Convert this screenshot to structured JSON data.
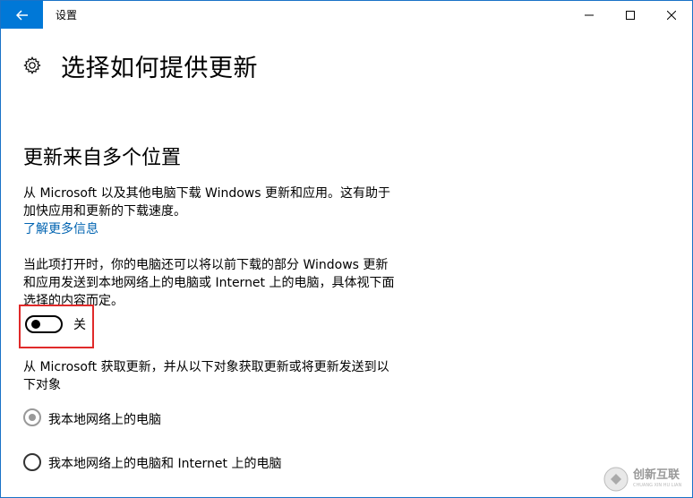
{
  "window": {
    "title": "设置"
  },
  "header": {
    "title": "选择如何提供更新",
    "icon": "gear-icon"
  },
  "section": {
    "title": "更新来自多个位置",
    "description": [
      "从 Microsoft 以及其他电脑下载 Windows 更新和应用。这有助于",
      "加快应用和更新的下载速度。"
    ],
    "link": "了解更多信息",
    "toggle_description": [
      "当此项打开时，你的电脑还可以将以前下载的部分 Windows 更新",
      "和应用发送到本地网络上的电脑或 Internet 上的电脑，具体视下面",
      "选择的内容而定。"
    ],
    "toggle": {
      "state_label": "关",
      "on": false
    },
    "source_description": [
      "从 Microsoft 获取更新，并从以下对象获取更新或将更新发送到以",
      "下对象"
    ],
    "options": [
      {
        "label": "我本地网络上的电脑",
        "selected": true
      },
      {
        "label": "我本地网络上的电脑和 Internet 上的电脑",
        "selected": false
      }
    ]
  },
  "colors": {
    "accent": "#0078d7",
    "link": "#0063b1",
    "highlight": "#e02a2a"
  },
  "watermark": {
    "text": "创新互联",
    "subtext": "CHUANG XIN HU LIAN"
  }
}
